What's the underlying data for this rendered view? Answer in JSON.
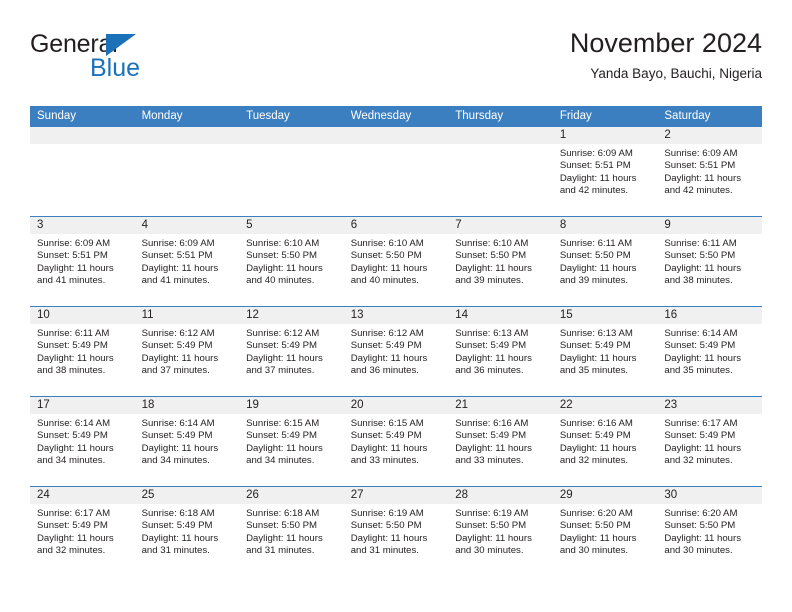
{
  "logo": {
    "top_text": "General",
    "bottom_text": "Blue",
    "triangle_color": "#1b72b8",
    "icon": "triangle-icon"
  },
  "header": {
    "title": "November 2024",
    "subtitle": "Yanda Bayo, Bauchi, Nigeria"
  },
  "theme": {
    "header_blue": "#3c7fc0",
    "daynum_band": "#f0f0f0",
    "text": "#231f20",
    "logo_blue": "#1b72b8"
  },
  "weekday_headers": [
    "Sunday",
    "Monday",
    "Tuesday",
    "Wednesday",
    "Thursday",
    "Friday",
    "Saturday"
  ],
  "weeks": [
    [
      {
        "day": "",
        "sunrise": "",
        "sunset": "",
        "daylight1": "",
        "daylight2": ""
      },
      {
        "day": "",
        "sunrise": "",
        "sunset": "",
        "daylight1": "",
        "daylight2": ""
      },
      {
        "day": "",
        "sunrise": "",
        "sunset": "",
        "daylight1": "",
        "daylight2": ""
      },
      {
        "day": "",
        "sunrise": "",
        "sunset": "",
        "daylight1": "",
        "daylight2": ""
      },
      {
        "day": "",
        "sunrise": "",
        "sunset": "",
        "daylight1": "",
        "daylight2": ""
      },
      {
        "day": "1",
        "sunrise": "Sunrise: 6:09 AM",
        "sunset": "Sunset: 5:51 PM",
        "daylight1": "Daylight: 11 hours",
        "daylight2": "and 42 minutes."
      },
      {
        "day": "2",
        "sunrise": "Sunrise: 6:09 AM",
        "sunset": "Sunset: 5:51 PM",
        "daylight1": "Daylight: 11 hours",
        "daylight2": "and 42 minutes."
      }
    ],
    [
      {
        "day": "3",
        "sunrise": "Sunrise: 6:09 AM",
        "sunset": "Sunset: 5:51 PM",
        "daylight1": "Daylight: 11 hours",
        "daylight2": "and 41 minutes."
      },
      {
        "day": "4",
        "sunrise": "Sunrise: 6:09 AM",
        "sunset": "Sunset: 5:51 PM",
        "daylight1": "Daylight: 11 hours",
        "daylight2": "and 41 minutes."
      },
      {
        "day": "5",
        "sunrise": "Sunrise: 6:10 AM",
        "sunset": "Sunset: 5:50 PM",
        "daylight1": "Daylight: 11 hours",
        "daylight2": "and 40 minutes."
      },
      {
        "day": "6",
        "sunrise": "Sunrise: 6:10 AM",
        "sunset": "Sunset: 5:50 PM",
        "daylight1": "Daylight: 11 hours",
        "daylight2": "and 40 minutes."
      },
      {
        "day": "7",
        "sunrise": "Sunrise: 6:10 AM",
        "sunset": "Sunset: 5:50 PM",
        "daylight1": "Daylight: 11 hours",
        "daylight2": "and 39 minutes."
      },
      {
        "day": "8",
        "sunrise": "Sunrise: 6:11 AM",
        "sunset": "Sunset: 5:50 PM",
        "daylight1": "Daylight: 11 hours",
        "daylight2": "and 39 minutes."
      },
      {
        "day": "9",
        "sunrise": "Sunrise: 6:11 AM",
        "sunset": "Sunset: 5:50 PM",
        "daylight1": "Daylight: 11 hours",
        "daylight2": "and 38 minutes."
      }
    ],
    [
      {
        "day": "10",
        "sunrise": "Sunrise: 6:11 AM",
        "sunset": "Sunset: 5:49 PM",
        "daylight1": "Daylight: 11 hours",
        "daylight2": "and 38 minutes."
      },
      {
        "day": "11",
        "sunrise": "Sunrise: 6:12 AM",
        "sunset": "Sunset: 5:49 PM",
        "daylight1": "Daylight: 11 hours",
        "daylight2": "and 37 minutes."
      },
      {
        "day": "12",
        "sunrise": "Sunrise: 6:12 AM",
        "sunset": "Sunset: 5:49 PM",
        "daylight1": "Daylight: 11 hours",
        "daylight2": "and 37 minutes."
      },
      {
        "day": "13",
        "sunrise": "Sunrise: 6:12 AM",
        "sunset": "Sunset: 5:49 PM",
        "daylight1": "Daylight: 11 hours",
        "daylight2": "and 36 minutes."
      },
      {
        "day": "14",
        "sunrise": "Sunrise: 6:13 AM",
        "sunset": "Sunset: 5:49 PM",
        "daylight1": "Daylight: 11 hours",
        "daylight2": "and 36 minutes."
      },
      {
        "day": "15",
        "sunrise": "Sunrise: 6:13 AM",
        "sunset": "Sunset: 5:49 PM",
        "daylight1": "Daylight: 11 hours",
        "daylight2": "and 35 minutes."
      },
      {
        "day": "16",
        "sunrise": "Sunrise: 6:14 AM",
        "sunset": "Sunset: 5:49 PM",
        "daylight1": "Daylight: 11 hours",
        "daylight2": "and 35 minutes."
      }
    ],
    [
      {
        "day": "17",
        "sunrise": "Sunrise: 6:14 AM",
        "sunset": "Sunset: 5:49 PM",
        "daylight1": "Daylight: 11 hours",
        "daylight2": "and 34 minutes."
      },
      {
        "day": "18",
        "sunrise": "Sunrise: 6:14 AM",
        "sunset": "Sunset: 5:49 PM",
        "daylight1": "Daylight: 11 hours",
        "daylight2": "and 34 minutes."
      },
      {
        "day": "19",
        "sunrise": "Sunrise: 6:15 AM",
        "sunset": "Sunset: 5:49 PM",
        "daylight1": "Daylight: 11 hours",
        "daylight2": "and 34 minutes."
      },
      {
        "day": "20",
        "sunrise": "Sunrise: 6:15 AM",
        "sunset": "Sunset: 5:49 PM",
        "daylight1": "Daylight: 11 hours",
        "daylight2": "and 33 minutes."
      },
      {
        "day": "21",
        "sunrise": "Sunrise: 6:16 AM",
        "sunset": "Sunset: 5:49 PM",
        "daylight1": "Daylight: 11 hours",
        "daylight2": "and 33 minutes."
      },
      {
        "day": "22",
        "sunrise": "Sunrise: 6:16 AM",
        "sunset": "Sunset: 5:49 PM",
        "daylight1": "Daylight: 11 hours",
        "daylight2": "and 32 minutes."
      },
      {
        "day": "23",
        "sunrise": "Sunrise: 6:17 AM",
        "sunset": "Sunset: 5:49 PM",
        "daylight1": "Daylight: 11 hours",
        "daylight2": "and 32 minutes."
      }
    ],
    [
      {
        "day": "24",
        "sunrise": "Sunrise: 6:17 AM",
        "sunset": "Sunset: 5:49 PM",
        "daylight1": "Daylight: 11 hours",
        "daylight2": "and 32 minutes."
      },
      {
        "day": "25",
        "sunrise": "Sunrise: 6:18 AM",
        "sunset": "Sunset: 5:49 PM",
        "daylight1": "Daylight: 11 hours",
        "daylight2": "and 31 minutes."
      },
      {
        "day": "26",
        "sunrise": "Sunrise: 6:18 AM",
        "sunset": "Sunset: 5:50 PM",
        "daylight1": "Daylight: 11 hours",
        "daylight2": "and 31 minutes."
      },
      {
        "day": "27",
        "sunrise": "Sunrise: 6:19 AM",
        "sunset": "Sunset: 5:50 PM",
        "daylight1": "Daylight: 11 hours",
        "daylight2": "and 31 minutes."
      },
      {
        "day": "28",
        "sunrise": "Sunrise: 6:19 AM",
        "sunset": "Sunset: 5:50 PM",
        "daylight1": "Daylight: 11 hours",
        "daylight2": "and 30 minutes."
      },
      {
        "day": "29",
        "sunrise": "Sunrise: 6:20 AM",
        "sunset": "Sunset: 5:50 PM",
        "daylight1": "Daylight: 11 hours",
        "daylight2": "and 30 minutes."
      },
      {
        "day": "30",
        "sunrise": "Sunrise: 6:20 AM",
        "sunset": "Sunset: 5:50 PM",
        "daylight1": "Daylight: 11 hours",
        "daylight2": "and 30 minutes."
      }
    ]
  ]
}
